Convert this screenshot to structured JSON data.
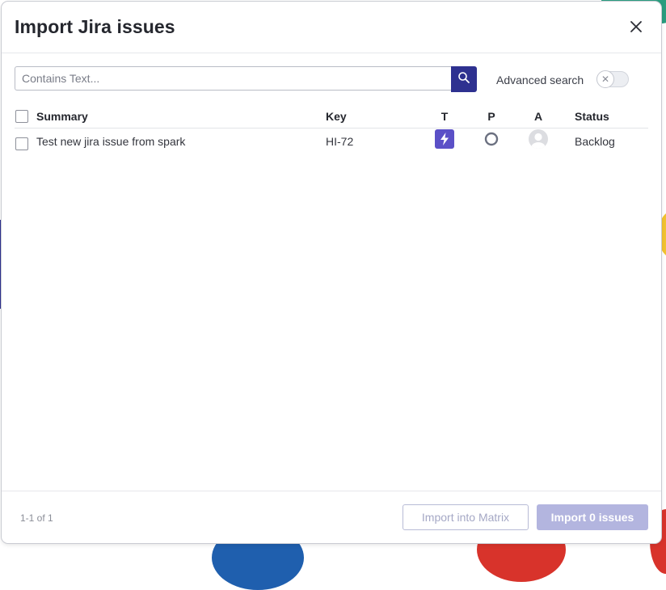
{
  "dialog": {
    "title": "Import Jira issues",
    "close_icon": "close-icon"
  },
  "search": {
    "placeholder": "Contains Text...",
    "value": "",
    "button_icon": "search-icon",
    "advanced_label": "Advanced search",
    "advanced_enabled": false
  },
  "table": {
    "columns": {
      "summary": "Summary",
      "key": "Key",
      "type": "T",
      "priority": "P",
      "assignee": "A",
      "status": "Status"
    },
    "rows": [
      {
        "selected": false,
        "summary": "Test new jira issue from spark",
        "key": "HI-72",
        "type_icon": "lightning-icon",
        "priority_icon": "priority-circle-icon",
        "assignee_icon": "avatar-icon",
        "status": "Backlog"
      }
    ]
  },
  "footer": {
    "pagination": "1-1 of 1",
    "import_matrix_label": "Import into Matrix",
    "import_issues_label": "Import 0 issues"
  },
  "colors": {
    "accent": "#2e3190",
    "type_icon_bg": "#5b50c7",
    "primary_disabled": "#b3b5df"
  }
}
